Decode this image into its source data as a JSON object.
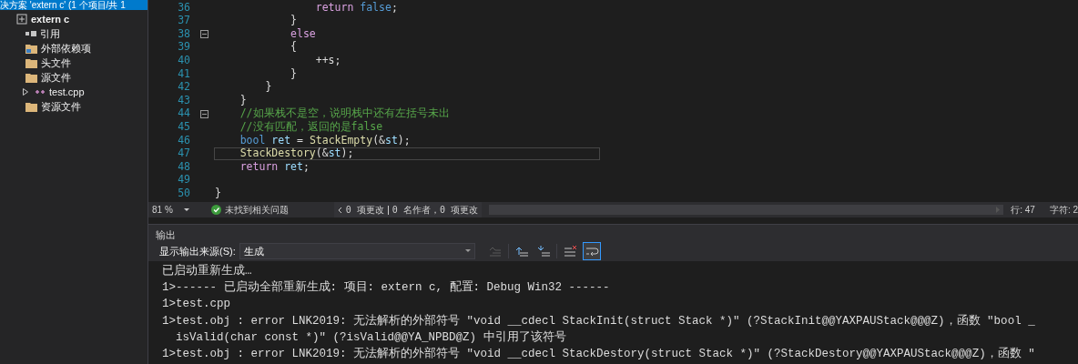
{
  "solution_explorer": {
    "header": {
      "title": "决方案 'extern c' (1 个项目/共 1",
      "selected": true
    },
    "tree": [
      {
        "label": "extern c",
        "kind": "project",
        "expanded": true,
        "children": [
          {
            "label": "引用",
            "kind": "references"
          },
          {
            "label": "外部依赖项",
            "kind": "folder-ext"
          },
          {
            "label": "头文件",
            "kind": "folder"
          },
          {
            "label": "源文件",
            "kind": "folder",
            "expanded": true,
            "children": [
              {
                "label": "test.cpp",
                "kind": "file",
                "expanded": false
              }
            ]
          },
          {
            "label": "资源文件",
            "kind": "folder"
          }
        ]
      }
    ]
  },
  "editor": {
    "lines": [
      {
        "number": "36",
        "tokens": [
          {
            "text": "                return ",
            "kind": "control"
          },
          {
            "text": "false",
            "kind": "keyword"
          },
          {
            "text": ";",
            "kind": "plain"
          }
        ]
      },
      {
        "number": "37",
        "tokens": [
          {
            "text": "            }",
            "kind": "plain"
          }
        ]
      },
      {
        "number": "38",
        "fold": true,
        "tokens": [
          {
            "text": "            else",
            "kind": "control"
          }
        ]
      },
      {
        "number": "39",
        "tokens": [
          {
            "text": "            {",
            "kind": "plain"
          }
        ]
      },
      {
        "number": "40",
        "tokens": [
          {
            "text": "                ++s;",
            "kind": "plain"
          }
        ]
      },
      {
        "number": "41",
        "tokens": [
          {
            "text": "            }",
            "kind": "plain"
          }
        ]
      },
      {
        "number": "42",
        "tokens": [
          {
            "text": "        }",
            "kind": "plain"
          }
        ]
      },
      {
        "number": "43",
        "tokens": [
          {
            "text": "    }",
            "kind": "plain"
          }
        ]
      },
      {
        "number": "44",
        "fold": true,
        "tokens": [
          {
            "text": "    //如果栈不是空，说明栈中还有左括号未出",
            "kind": "comment"
          }
        ]
      },
      {
        "number": "45",
        "tokens": [
          {
            "text": "    //没有匹配，返回的是false",
            "kind": "comment"
          }
        ]
      },
      {
        "number": "46",
        "tokens": [
          {
            "text": "    bool ",
            "kind": "keyword"
          },
          {
            "text": "ret",
            "kind": "variable"
          },
          {
            "text": " = ",
            "kind": "plain"
          },
          {
            "text": "StackEmpty",
            "kind": "function"
          },
          {
            "text": "(&",
            "kind": "plain"
          },
          {
            "text": "st",
            "kind": "variable"
          },
          {
            "text": ");",
            "kind": "plain"
          }
        ]
      },
      {
        "number": "47",
        "current": true,
        "tokens": [
          {
            "text": "    StackDestory",
            "kind": "function"
          },
          {
            "text": "(&",
            "kind": "plain"
          },
          {
            "text": "st",
            "kind": "variable"
          },
          {
            "text": ");",
            "kind": "plain"
          }
        ]
      },
      {
        "number": "48",
        "tokens": [
          {
            "text": "    return ",
            "kind": "control"
          },
          {
            "text": "ret",
            "kind": "variable"
          },
          {
            "text": ";",
            "kind": "plain"
          }
        ]
      },
      {
        "number": "49"
      },
      {
        "number": "50",
        "tokens": [
          {
            "text": "}",
            "kind": "plain"
          }
        ]
      }
    ]
  },
  "status_bar": {
    "zoom": "81 %",
    "issues": "未找到相关问题",
    "changes": "0 项更改",
    "authors": "0 名作者，0 项更改",
    "line": "行: 47",
    "char": "字符: 2"
  },
  "output": {
    "title": "输出",
    "source_label": "显示输出来源(S):",
    "source": "生成",
    "toolbar": [
      {
        "kind": "prev",
        "disabled": true,
        "selected": false
      },
      {
        "kind": "up",
        "disabled": false,
        "selected": false
      },
      {
        "kind": "down",
        "disabled": false,
        "selected": false
      },
      {
        "kind": "clear",
        "disabled": false,
        "selected": false
      },
      {
        "kind": "wrap",
        "disabled": false,
        "selected": true
      }
    ],
    "lines": [
      "已启动重新生成…",
      "1>------ 已启动全部重新生成: 项目: extern c, 配置: Debug Win32 ------",
      "1>test.cpp",
      "1>test.obj : error LNK2019: 无法解析的外部符号 \"void __cdecl StackInit(struct Stack *)\" (?StackInit@@YAXPAUStack@@@Z)，函数 \"bool _",
      "  isValid(char const *)\" (?isValid@@YA_NPBD@Z) 中引用了该符号",
      "1>test.obj : error LNK2019: 无法解析的外部符号 \"void __cdecl StackDestory(struct Stack *)\" (?StackDestory@@YAXPAUStack@@@Z)，函数 \""
    ]
  }
}
